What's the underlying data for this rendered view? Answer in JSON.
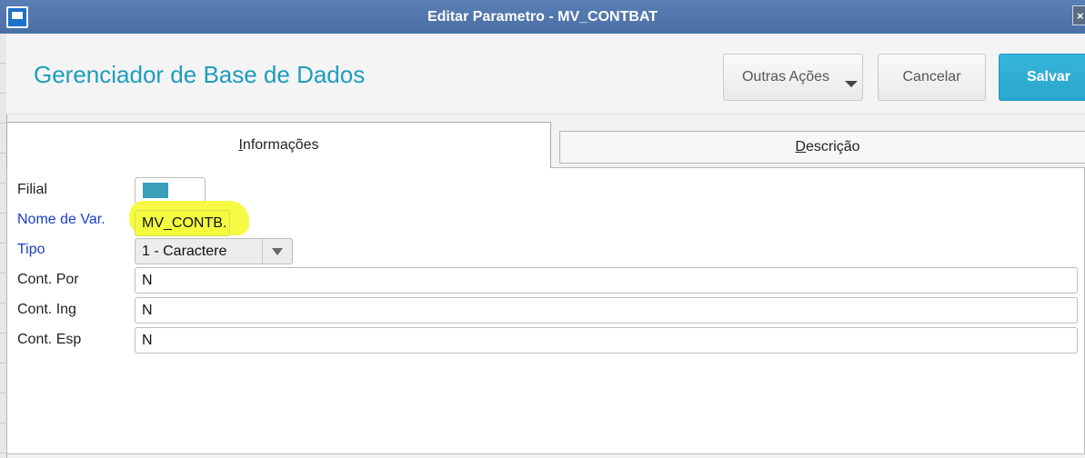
{
  "window": {
    "title": "Editar Parametro - MV_CONTBAT",
    "close_glyph": "×"
  },
  "header": {
    "title": "Gerenciador de Base de Dados"
  },
  "toolbar": {
    "outras_label": "Outras Ações",
    "cancelar_label": "Cancelar",
    "salvar_label": "Salvar"
  },
  "tabs": [
    {
      "label_underlined": "I",
      "label_rest": "nformações",
      "active": true
    },
    {
      "label_underlined": "D",
      "label_rest": "escrição",
      "active": false
    }
  ],
  "form": {
    "filial": {
      "label": "Filial",
      "color": "#3c9fb9"
    },
    "nome_var": {
      "label": "Nome de Var.",
      "value": "MV_CONTB."
    },
    "tipo": {
      "label": "Tipo",
      "value": "1 - Caractere"
    },
    "cont_por": {
      "label": "Cont. Por",
      "value": "N"
    },
    "cont_ing": {
      "label": "Cont. Ing",
      "value": "N"
    },
    "cont_esp": {
      "label": "Cont. Esp",
      "value": "N"
    }
  },
  "colors": {
    "title_bar": "#4a6fa5",
    "accent": "#1e9dbd",
    "save_button": "#2aa6cf",
    "required_label": "#1a3fc9",
    "highlight": "#f6fa30"
  }
}
